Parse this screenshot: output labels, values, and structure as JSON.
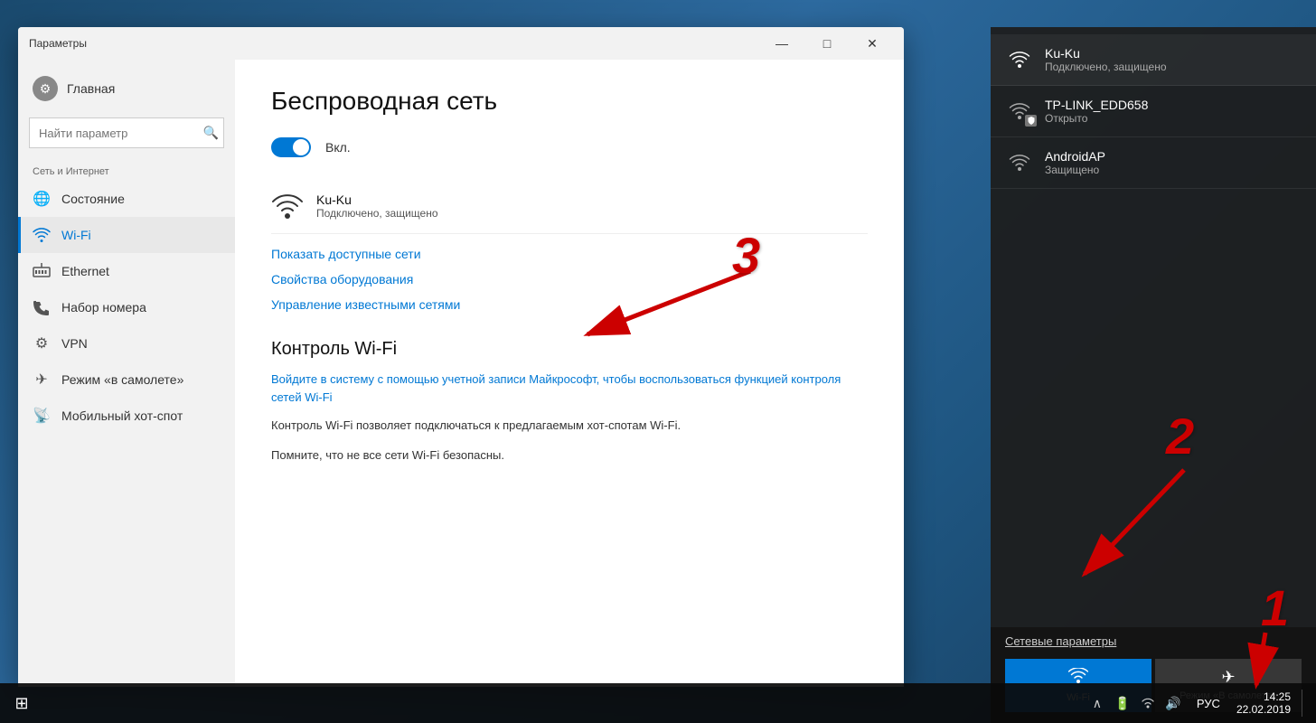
{
  "window": {
    "title": "Параметры",
    "controls": {
      "minimize": "—",
      "maximize": "□",
      "close": "✕"
    }
  },
  "sidebar": {
    "home_label": "Главная",
    "search_placeholder": "Найти параметр",
    "section_label": "Сеть и Интернет",
    "items": [
      {
        "id": "status",
        "icon": "🌐",
        "label": "Состояние"
      },
      {
        "id": "wifi",
        "icon": "📶",
        "label": "Wi-Fi",
        "active": true
      },
      {
        "id": "ethernet",
        "icon": "🖥",
        "label": "Ethernet"
      },
      {
        "id": "dialup",
        "icon": "📞",
        "label": "Набор номера"
      },
      {
        "id": "vpn",
        "icon": "⚙",
        "label": "VPN"
      },
      {
        "id": "airplane",
        "icon": "✈",
        "label": "Режим «в самолете»"
      },
      {
        "id": "hotspot",
        "icon": "📡",
        "label": "Мобильный хот-спот"
      }
    ]
  },
  "main": {
    "title": "Беспроводная сеть",
    "toggle_label": "Вкл.",
    "connected_network": {
      "name": "Ku-Ku",
      "status": "Подключено, защищено"
    },
    "links": {
      "show_networks": "Показать доступные сети",
      "adapter_properties": "Свойства оборудования",
      "manage_networks": "Управление известными сетями"
    },
    "wifi_sense_title": "Контроль Wi-Fi",
    "wifi_sense_login_link": "Войдите в систему с помощью учетной записи Майкрософт, чтобы воспользоваться функцией контроля сетей Wi-Fi",
    "wifi_sense_desc1": "Контроль Wi-Fi позволяет подключаться к предлагаемым хот-спотам Wi-Fi.",
    "wifi_sense_desc2": "Помните, что не все сети Wi-Fi безопасны."
  },
  "wifi_panel": {
    "networks": [
      {
        "name": "Ku-Ku",
        "status": "Подключено, защищено",
        "connected": true,
        "secured": false
      },
      {
        "name": "TP-LINK_EDD658",
        "status": "Открыто",
        "connected": false,
        "secured": true
      },
      {
        "name": "AndroidAP",
        "status": "Защищено",
        "connected": false,
        "secured": false
      }
    ],
    "network_settings_label": "Сетевые параметры",
    "buttons": [
      {
        "id": "wifi",
        "label": "Wi-Fi",
        "active": true
      },
      {
        "id": "airplane",
        "label": "Режим «В самолете»",
        "active": false
      }
    ]
  },
  "taskbar": {
    "language": "РУС",
    "time": "14:25",
    "date": "22.02.2019"
  },
  "annotations": {
    "num1": "1",
    "num2": "2",
    "num3": "3"
  }
}
